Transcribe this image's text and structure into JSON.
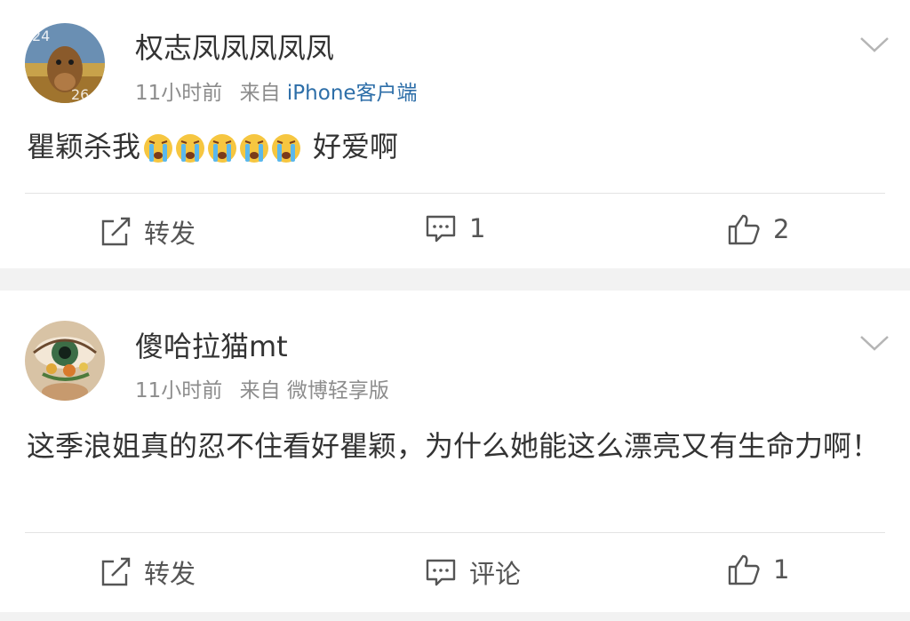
{
  "posts": [
    {
      "username": "权志凤凤凤凤凤",
      "time": "11小时前",
      "from_label": "来自",
      "source": "iPhone客户端",
      "content_prefix": "瞿颖杀我",
      "emojis": [
        "crying-emoji",
        "crying-emoji",
        "crying-emoji",
        "crying-emoji",
        "crying-emoji"
      ],
      "content_suffix": "好爱啊",
      "avatar_text": [
        "24",
        "26"
      ],
      "actions": {
        "repost_label": "转发",
        "comment_value": "1",
        "like_value": "2"
      }
    },
    {
      "username": "傻哈拉猫mt",
      "time": "11小时前",
      "from_label": "来自",
      "source": "微博轻享版",
      "content": "这季浪姐真的忍不住看好瞿颖，为什么她能这么漂亮又有生命力啊！",
      "actions": {
        "repost_label": "转发",
        "comment_label": "评论",
        "like_value": "1"
      }
    }
  ],
  "colors": {
    "background": "#f2f2f2",
    "card": "#ffffff",
    "text": "#333333",
    "meta": "#8c8c8c",
    "link": "#2d6ea8",
    "divider": "#e3e3e3"
  },
  "icons": [
    "repost-icon",
    "comment-icon",
    "like-icon",
    "chevron-down-icon"
  ]
}
